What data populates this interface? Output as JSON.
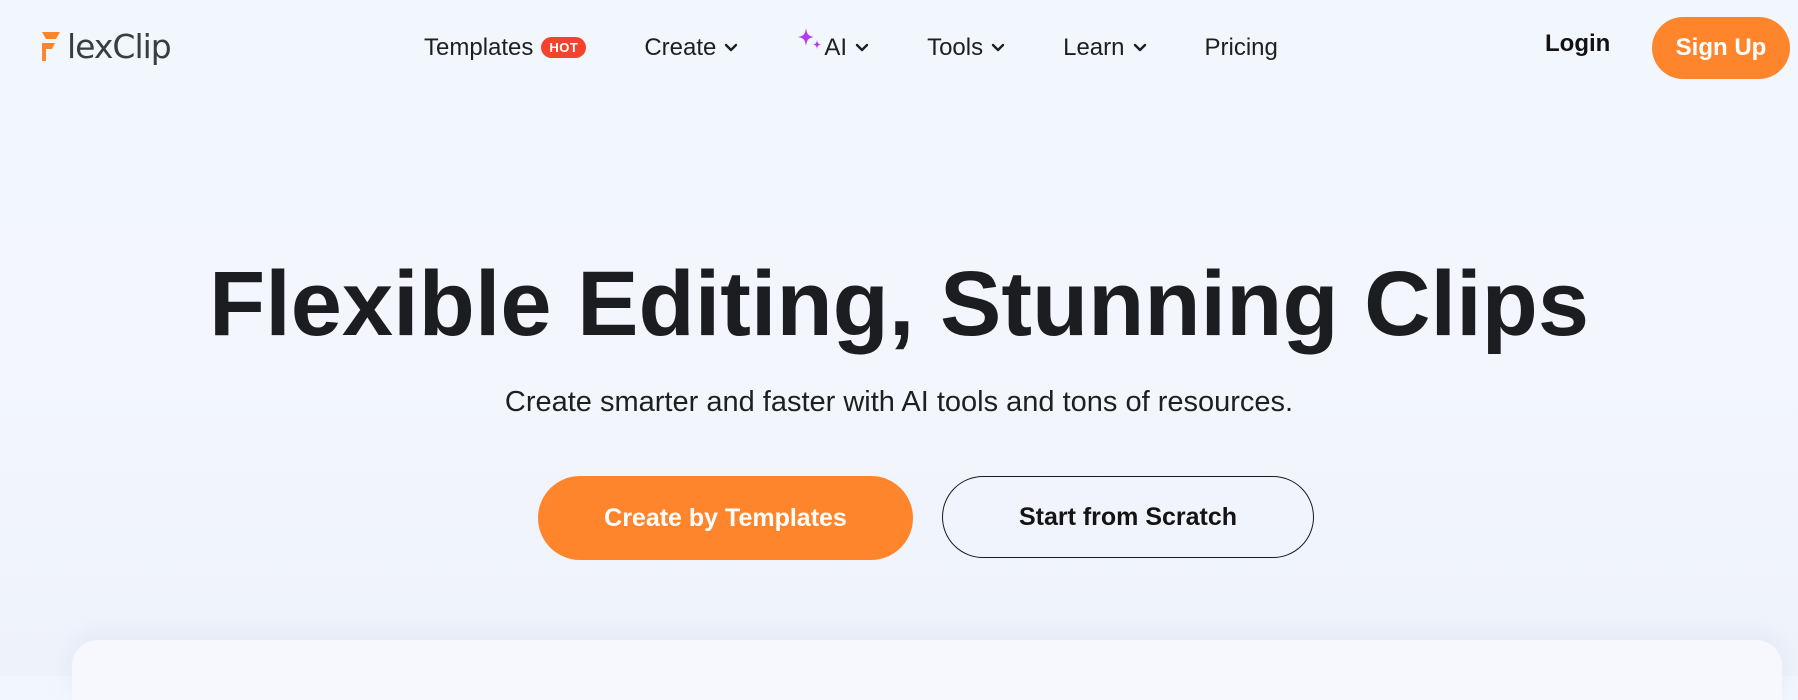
{
  "brand": {
    "name": "FlexClip",
    "name_rest": "lexClip",
    "accent": "#ff852d"
  },
  "nav": {
    "items": [
      {
        "label": "Templates",
        "badge": "HOT",
        "dropdown": false
      },
      {
        "label": "Create",
        "dropdown": true
      },
      {
        "label": "AI",
        "dropdown": true,
        "icon": "sparkle-icon"
      },
      {
        "label": "Tools",
        "dropdown": true
      },
      {
        "label": "Learn",
        "dropdown": true
      },
      {
        "label": "Pricing",
        "dropdown": false
      }
    ]
  },
  "auth": {
    "login_label": "Login",
    "signup_label": "Sign Up"
  },
  "hero": {
    "title": "Flexible Editing, Stunning Clips",
    "subtitle": "Create smarter and faster with AI tools and tons of resources.",
    "primary_cta": "Create by Templates",
    "secondary_cta": "Start from Scratch"
  },
  "colors": {
    "hot_badge": "#f4432d",
    "sparkle": "#b43cf0",
    "text_dark": "#1c1d21"
  }
}
